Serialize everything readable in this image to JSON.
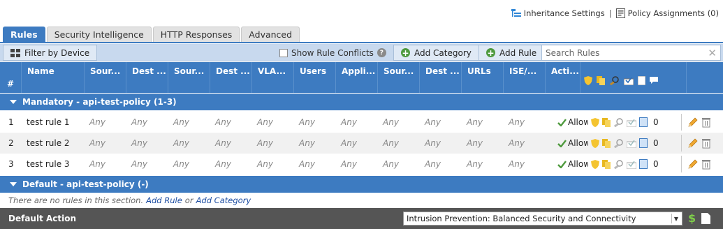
{
  "top_links": {
    "inheritance": "Inheritance Settings",
    "separator": "|",
    "assignments": "Policy Assignments (0)"
  },
  "tabs": [
    {
      "label": "Rules",
      "active": true
    },
    {
      "label": "Security Intelligence",
      "active": false
    },
    {
      "label": "HTTP Responses",
      "active": false
    },
    {
      "label": "Advanced",
      "active": false
    }
  ],
  "toolbar": {
    "filter_label": "Filter by Device",
    "conflicts_label": "Show Rule Conflicts",
    "conflicts_checked": false,
    "add_category_label": "Add Category",
    "add_rule_label": "Add Rule",
    "search_placeholder": "Search Rules",
    "search_value": ""
  },
  "columns": [
    "#",
    "Name",
    "Sour...",
    "Dest ...",
    "Sour...",
    "Dest ...",
    "VLA...",
    "Users",
    "Appli...",
    "Sour...",
    "Dest ...",
    "URLs",
    "ISE/...",
    "Acti..."
  ],
  "header_icons": [
    "shield-icon",
    "files-icon",
    "inspect-icon",
    "log-icon",
    "page-icon",
    "comment-icon"
  ],
  "sections": [
    {
      "title": "Mandatory - api-test-policy (1-3)",
      "rules": [
        {
          "num": "1",
          "name": "test rule 1",
          "cells": [
            "Any",
            "Any",
            "Any",
            "Any",
            "Any",
            "Any",
            "Any",
            "Any",
            "Any",
            "Any",
            "Any"
          ],
          "action": "Allow",
          "comments": "0"
        },
        {
          "num": "2",
          "name": "test rule 2",
          "cells": [
            "Any",
            "Any",
            "Any",
            "Any",
            "Any",
            "Any",
            "Any",
            "Any",
            "Any",
            "Any",
            "Any"
          ],
          "action": "Allow",
          "comments": "0"
        },
        {
          "num": "3",
          "name": "test rule 3",
          "cells": [
            "Any",
            "Any",
            "Any",
            "Any",
            "Any",
            "Any",
            "Any",
            "Any",
            "Any",
            "Any",
            "Any"
          ],
          "action": "Allow",
          "comments": "0"
        }
      ]
    },
    {
      "title": "Default - api-test-policy (-)",
      "rules": []
    }
  ],
  "empty_section": {
    "prefix": "There are no rules in this section.",
    "add_rule": "Add Rule",
    "or": "or",
    "add_category": "Add Category"
  },
  "default_action": {
    "label": "Default Action",
    "value": "Intrusion Prevention: Balanced Security and Connectivity"
  },
  "colors": {
    "header_blue": "#3d7bc1",
    "toolbar_blue": "#c8d9ee",
    "default_bar": "#555555",
    "allow_green": "#4f9a3e"
  }
}
